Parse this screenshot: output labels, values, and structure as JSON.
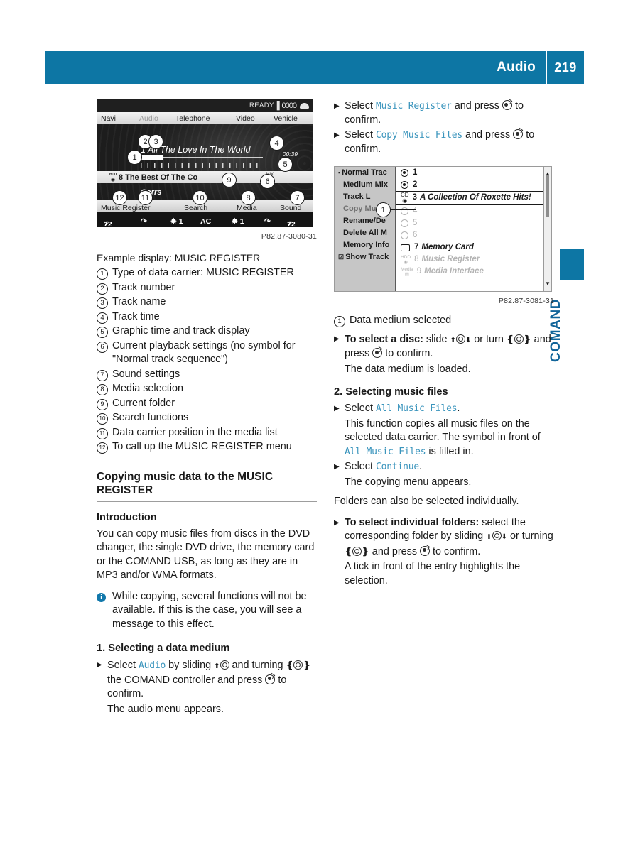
{
  "header": {
    "title": "Audio",
    "page_number": "219"
  },
  "side_tab": {
    "label": "COMAND"
  },
  "figure1": {
    "caption": "P82.87-3080-31",
    "statusbar": {
      "ready": "READY",
      "signal": "▌0000",
      "phone_icon": "phone-icon"
    },
    "menubar": [
      "Navi",
      "Audio",
      "Telephone",
      "Video",
      "Vehicle"
    ],
    "track_title": "1 All The Love In The World",
    "track_time": "00:39",
    "album_prefix_icon": "hdd-disc-icon",
    "album": "8 The Best Of The Co",
    "mix_icon": "MIX",
    "artist": "Corrs",
    "softkeys": [
      "Music Register",
      "Search",
      "Media",
      "Sound"
    ],
    "climate": [
      "72",
      "seat-icon",
      "✸ 1",
      "AC",
      "✸ 1",
      "seat-icon",
      "72"
    ],
    "callouts": [
      "1",
      "2",
      "3",
      "4",
      "5",
      "6",
      "7",
      "8",
      "9",
      "10",
      "11",
      "12"
    ]
  },
  "figure2": {
    "caption": "P82.87-3081-31",
    "left_menu": [
      {
        "label": "Normal Trac",
        "state": "bullet"
      },
      {
        "label": "Medium Mix",
        "state": "normal"
      },
      {
        "label": "Track L",
        "state": "normal"
      },
      {
        "label": "Copy Music",
        "state": "dim"
      },
      {
        "label": "Rename/De",
        "state": "normal"
      },
      {
        "label": "Delete All M",
        "state": "normal"
      },
      {
        "label": "Memory Info",
        "state": "normal"
      },
      {
        "label": "Show Track",
        "state": "check"
      }
    ],
    "media_rows": [
      {
        "num": "1",
        "name": "",
        "icon": "radio-filled",
        "dim": false,
        "selected": false
      },
      {
        "num": "2",
        "name": "",
        "icon": "radio-filled",
        "dim": false,
        "selected": false
      },
      {
        "num": "3",
        "name": "A Collection Of Roxette Hits!",
        "icon": "cd-icon",
        "dim": false,
        "selected": true
      },
      {
        "num": "4",
        "name": "",
        "icon": "radio-empty",
        "dim": true,
        "selected": false
      },
      {
        "num": "5",
        "name": "",
        "icon": "radio-empty",
        "dim": true,
        "selected": false
      },
      {
        "num": "6",
        "name": "",
        "icon": "radio-empty",
        "dim": true,
        "selected": false
      },
      {
        "num": "7",
        "name": "Memory Card",
        "icon": "card-icon",
        "dim": false,
        "selected": false
      },
      {
        "num": "8",
        "name": "Music Register",
        "icon": "hdd-icon",
        "dim": true,
        "selected": false
      },
      {
        "num": "9",
        "name": "Media Interface",
        "icon": "media-icon",
        "dim": true,
        "selected": false
      }
    ],
    "callout": "1"
  },
  "left_column": {
    "legend_intro": "Example display: MUSIC REGISTER",
    "legend": [
      {
        "num": "1",
        "text": "Type of data carrier: MUSIC REGISTER"
      },
      {
        "num": "2",
        "text": "Track number"
      },
      {
        "num": "3",
        "text": "Track name"
      },
      {
        "num": "4",
        "text": "Track time"
      },
      {
        "num": "5",
        "text": "Graphic time and track display"
      },
      {
        "num": "6",
        "text": "Current playback settings (no symbol for \"Normal track sequence\")"
      },
      {
        "num": "7",
        "text": "Sound settings"
      },
      {
        "num": "8",
        "text": "Media selection"
      },
      {
        "num": "9",
        "text": "Current folder"
      },
      {
        "num": "10",
        "text": "Search functions"
      },
      {
        "num": "11",
        "text": "Data carrier position in the media list"
      },
      {
        "num": "12",
        "text": "To call up the MUSIC REGISTER menu"
      }
    ],
    "section_heading": "Copying music data to the MUSIC REGISTER",
    "intro_heading": "Introduction",
    "intro_body": "You can copy music files from discs in the DVD changer, the single DVD drive, the memory card or the COMAND USB, as long as they are in MP3 and/or WMA formats.",
    "note": "While copying, several functions will not be available. If this is the case, you will see a message to this effect.",
    "step1_heading": "1. Selecting a data medium",
    "step1_select_pre": "Select ",
    "step1_select_mono": "Audio",
    "step1_select_mid": " by sliding ",
    "step1_select_mid2": " and turning ",
    "step1_select_mid3": " the COMAND controller and press ",
    "step1_select_end": " to confirm.",
    "step1_result": "The audio menu appears."
  },
  "right_column": {
    "step_a_pre": "Select ",
    "step_a_mono": "Music Register",
    "step_a_mid": " and press ",
    "step_a_end": " to confirm.",
    "step_b_pre": "Select ",
    "step_b_mono": "Copy Music Files",
    "step_b_mid": " and press ",
    "step_b_end": " to confirm.",
    "fig2_legend_num": "1",
    "fig2_legend_text": "Data medium selected",
    "disc_label": "To select a disc:",
    "disc_mid": " slide ",
    "disc_mid2": " or turn ",
    "disc_mid3": " and press ",
    "disc_end": " to confirm.",
    "disc_result": "The data medium is loaded.",
    "step2_heading": "2. Selecting music files",
    "step2_select_pre": "Select ",
    "step2_select_mono": "All Music Files",
    "step2_select_end": ".",
    "step2_body_pre": "This function copies all music files on the selected data carrier. The symbol in front of ",
    "step2_body_mono": "All Music Files",
    "step2_body_end": " is filled in.",
    "continue_pre": "Select ",
    "continue_mono": "Continue",
    "continue_end": ".",
    "continue_result": "The copying menu appears.",
    "folders_note": "Folders can also be selected individually.",
    "folders_label": "To select individual folders:",
    "folders_mid": " select the corresponding folder by sliding ",
    "folders_mid2": " or turning ",
    "folders_mid3": " and press ",
    "folders_end": " to confirm.",
    "folders_result": "A tick in front of the entry highlights the selection."
  },
  "colors": {
    "brand_blue": "#0d76a4",
    "mono_blue": "#3b95bd",
    "note_blue": "#1178ab"
  }
}
